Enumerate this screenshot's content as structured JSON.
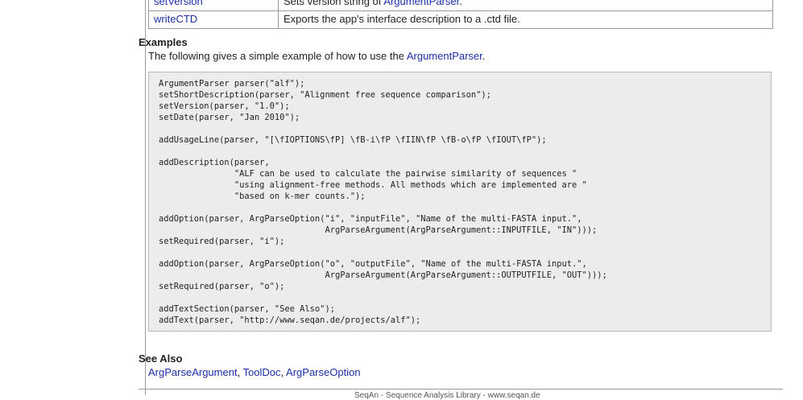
{
  "functions_table": {
    "rows": [
      {
        "name": "setVersion",
        "description_prefix": "Sets version string of ",
        "description_link": "ArgumentParser",
        "description_suffix": "."
      },
      {
        "name": "writeCTD",
        "description_prefix": "Exports the app's interface description to a .ctd file.",
        "description_link": "",
        "description_suffix": ""
      }
    ]
  },
  "examples": {
    "heading": "Examples",
    "intro_text": "The following gives a simple example of how to use the ",
    "intro_link": "ArgumentParser",
    "intro_suffix": ".",
    "code": "ArgumentParser parser(\"alf\");\nsetShortDescription(parser, \"Alignment free sequence comparison\");\nsetVersion(parser, \"1.0\");\nsetDate(parser, \"Jan 2010\");\n\naddUsageLine(parser, \"[\\fIOPTIONS\\fP] \\fB-i\\fP \\fIIN\\fP \\fB-o\\fP \\fIOUT\\fP\");\n\naddDescription(parser,\n               \"ALF can be used to calculate the pairwise similarity of sequences \"\n               \"using alignment-free methods. All methods which are implemented are \"\n               \"based on k-mer counts.\");\n\naddOption(parser, ArgParseOption(\"i\", \"inputFile\", \"Name of the multi-FASTA input.\",\n                                 ArgParseArgument(ArgParseArgument::INPUTFILE, \"IN\")));\nsetRequired(parser, \"i\");\n\naddOption(parser, ArgParseOption(\"o\", \"outputFile\", \"Name of the multi-FASTA input.\",\n                                 ArgParseArgument(ArgParseArgument::OUTPUTFILE, \"OUT\")));\nsetRequired(parser, \"o\");\n\naddTextSection(parser, \"See Also\");\naddText(parser, \"http://www.seqan.de/projects/alf\");"
  },
  "see_also": {
    "heading": "See Also",
    "links": [
      "ArgParseArgument",
      "ToolDoc",
      "ArgParseOption"
    ],
    "separator": ", "
  },
  "footer": {
    "text": "SeqAn - Sequence Analysis Library - www.seqan.de"
  }
}
